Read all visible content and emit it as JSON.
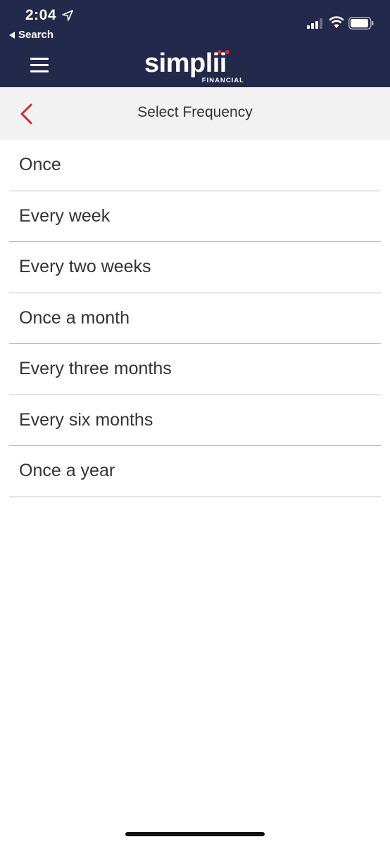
{
  "status_bar": {
    "time": "2:04",
    "back_app_label": "Search"
  },
  "brand": {
    "name": "simplii",
    "subtitle": "FINANCIAL",
    "accent_color": "#d8262e",
    "header_color": "#23294a"
  },
  "icons": {
    "menu": "hamburger-icon",
    "back": "chevron-left-icon",
    "location": "location-arrow-icon",
    "signal": "cellular-signal-icon",
    "wifi": "wifi-icon",
    "battery": "battery-icon"
  },
  "page": {
    "title": "Select Frequency"
  },
  "frequency_options": [
    "Once",
    "Every week",
    "Every two weeks",
    "Once a month",
    "Every three months",
    "Every six months",
    "Once a year"
  ]
}
